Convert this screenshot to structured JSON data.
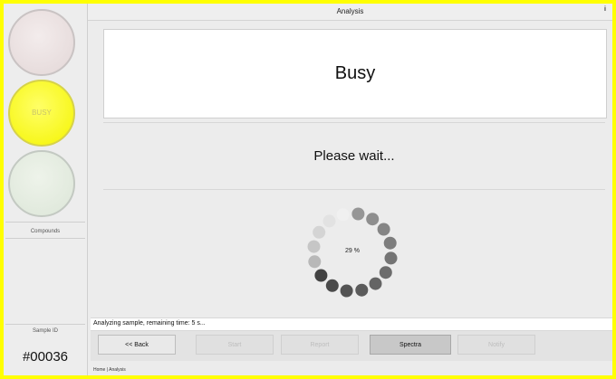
{
  "header": {
    "title": "Analysis",
    "info_icon": "info-icon"
  },
  "lamps": {
    "red": {
      "label": ""
    },
    "yellow": {
      "label": "BUSY"
    },
    "green": {
      "label": ""
    }
  },
  "left_panel": {
    "compounds_label": "Compounds",
    "sample_id_label": "Sample ID",
    "sample_number": "#00036"
  },
  "main": {
    "busy_text": "Busy",
    "wait_text": "Please wait...",
    "progress_label": "29 %",
    "progress_fraction": 0.29
  },
  "status": {
    "text": "Analyzing sample, remaining time: 5 s..."
  },
  "buttons": {
    "back": "<< Back",
    "start": "Start",
    "report": "Report",
    "spectra": "Spectra",
    "notify": "Notify"
  },
  "breadcrumb": "Home | Analysis",
  "colors": {
    "border": "#ffff00",
    "busy_lamp": "#ffff00"
  }
}
